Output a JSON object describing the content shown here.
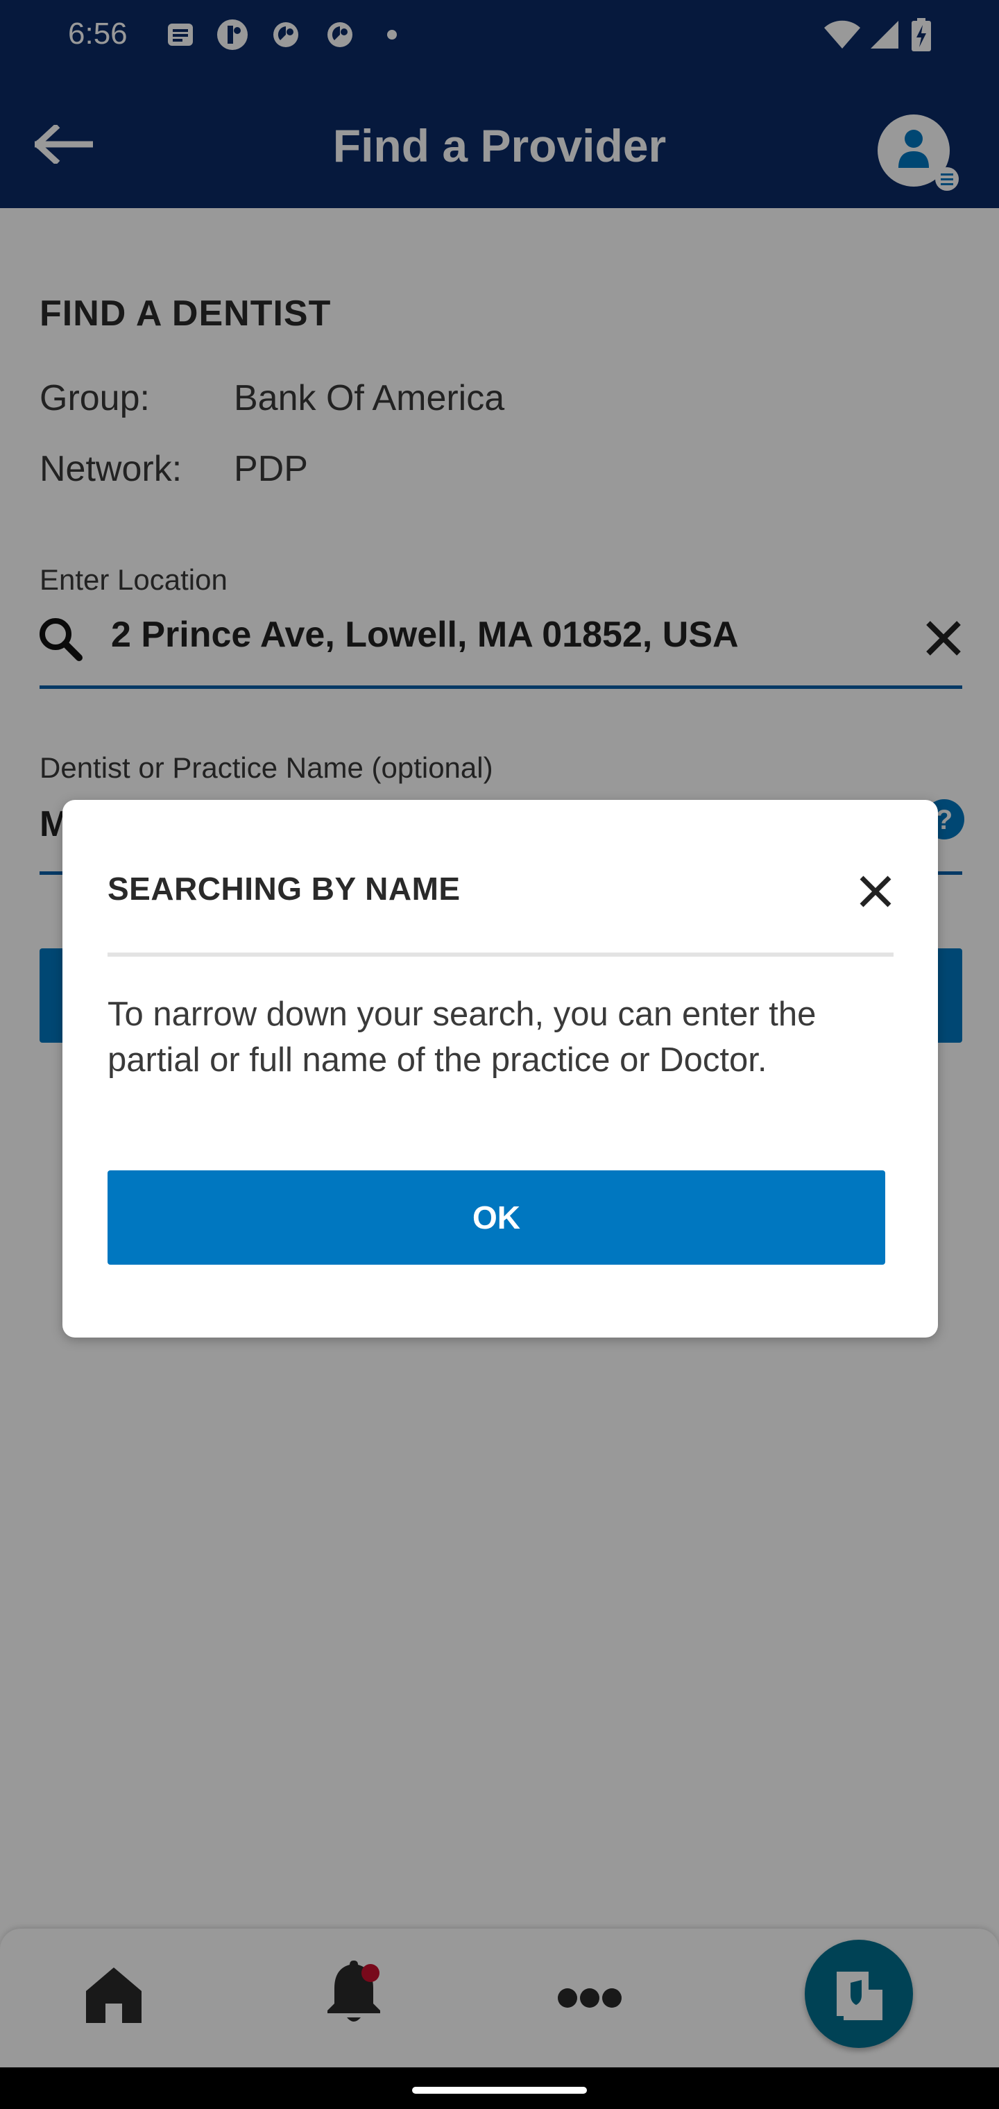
{
  "status_bar": {
    "time": "6:56"
  },
  "header": {
    "title": "Find a Provider",
    "back_icon": "arrow-left-icon",
    "profile_icon": "user-profile-icon"
  },
  "search_form": {
    "section_heading": "FIND A DENTIST",
    "group_label": "Group:",
    "group_value": "Bank Of America",
    "network_label": "Network:",
    "network_value": "PDP",
    "location_label": "Enter Location",
    "location_value": "2 Prince Ave, Lowell, MA 01852, USA",
    "name_label": "Dentist or Practice Name (optional)",
    "name_value_partial": "M"
  },
  "dialog": {
    "title": "SEARCHING BY NAME",
    "body": "To narrow down your search, you can enter the partial or full name of the practice or Doctor.",
    "ok_label": "OK"
  },
  "bottom_nav": {
    "items": [
      "home-icon",
      "bell-icon",
      "more-icon",
      "id-card-icon"
    ]
  },
  "colors": {
    "primary": "#0077c0",
    "header_bg": "#0a2a66",
    "notification_dot": "#c8102e"
  }
}
